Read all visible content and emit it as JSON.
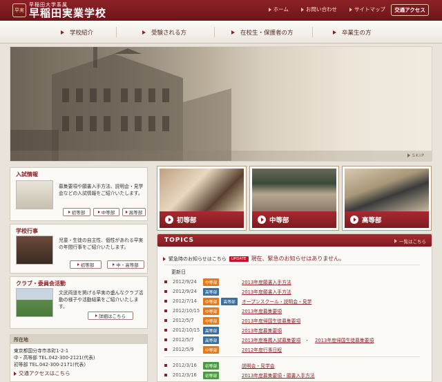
{
  "header": {
    "logo_sub": "早稲田大学系属",
    "logo_main": "早稲田実業学校",
    "links": [
      "ホーム",
      "お問い合わせ",
      "サイトマップ"
    ],
    "access_button": "交通アクセス"
  },
  "nav": [
    "学校紹介",
    "受験される方",
    "在校生・保護者の方",
    "卒業生の方"
  ],
  "hero": {
    "skip_label": "SKIP"
  },
  "sidebar": {
    "admissions": {
      "title": "入試情報",
      "desc": "募集要項や願書入手方法、説明会・見学会などの入試情報をご紹介いたします。",
      "buttons": [
        "初等部",
        "中等部",
        "高等部"
      ]
    },
    "events": {
      "title": "学校行事",
      "desc": "児童・生徒の自主性、個性があれる早実の年間行事をご紹介いたします。",
      "buttons": [
        "初等部",
        "中・高等部"
      ]
    },
    "clubs": {
      "title": "クラブ・委員会活動",
      "desc": "文武両道を掲げる早実の盛んなクラブ活動の様子や活動結果をご紹介いたします。",
      "button": "詳細はこちら"
    },
    "address": {
      "heading": "所在地",
      "line1": "東京都国分寺市本町1-2-1",
      "line2": "中・高等部 TEL.042-300-2121(代表)",
      "line3": "初等部 TEL.042-300-2171(代表)",
      "link": "交通アクセスはこちら"
    }
  },
  "schools": [
    "初等部",
    "中等部",
    "高等部"
  ],
  "topics": {
    "title": "TOPICS",
    "more": "一覧はこちら",
    "emergency_label": "緊急時のお知らせはこちら",
    "update_badge": "UPDATE",
    "emergency_msg": "現在、緊急のお知らせはありません。",
    "updated_label": "更新日",
    "items": [
      {
        "date": "2012/9/24",
        "tags": [
          "中等部"
        ],
        "title": "2013年度願書入手方法"
      },
      {
        "date": "2012/9/24",
        "tags": [
          "高等部"
        ],
        "title": "2013年度願書入手方法"
      },
      {
        "date": "2012/7/14",
        "tags": [
          "中等部",
          "高等部"
        ],
        "title": "オープンスクール・説明会・見学"
      },
      {
        "date": "2012/10/15",
        "tags": [
          "中等部"
        ],
        "title": "2013年度募集要項"
      },
      {
        "date": "2012/5/7",
        "tags": [
          "中等部"
        ],
        "title": "2013年度帰国生徒募集要項"
      },
      {
        "date": "2012/10/15",
        "tags": [
          "高等部"
        ],
        "title": "2013年度募集要項"
      },
      {
        "date": "2012/5/7",
        "tags": [
          "高等部"
        ],
        "title": "2013年度推薦入試募集要項",
        "title2": "2013年度帰国生徒募集要項"
      },
      {
        "date": "2012/5/9",
        "tags": [
          "中等部"
        ],
        "title": "2012年度行事日程"
      },
      {
        "date": "2012/3/16",
        "tags": [
          "初等部"
        ],
        "title": "説明会・見学会"
      },
      {
        "date": "2012/3/16",
        "tags": [
          "初等部"
        ],
        "title": "2013年度募集要項・願書入手方法"
      }
    ]
  },
  "colors": {
    "brand": "#8c2127",
    "tag_j": "#e07b22",
    "tag_h": "#3a6e9c",
    "tag_e": "#4a9b3c"
  }
}
